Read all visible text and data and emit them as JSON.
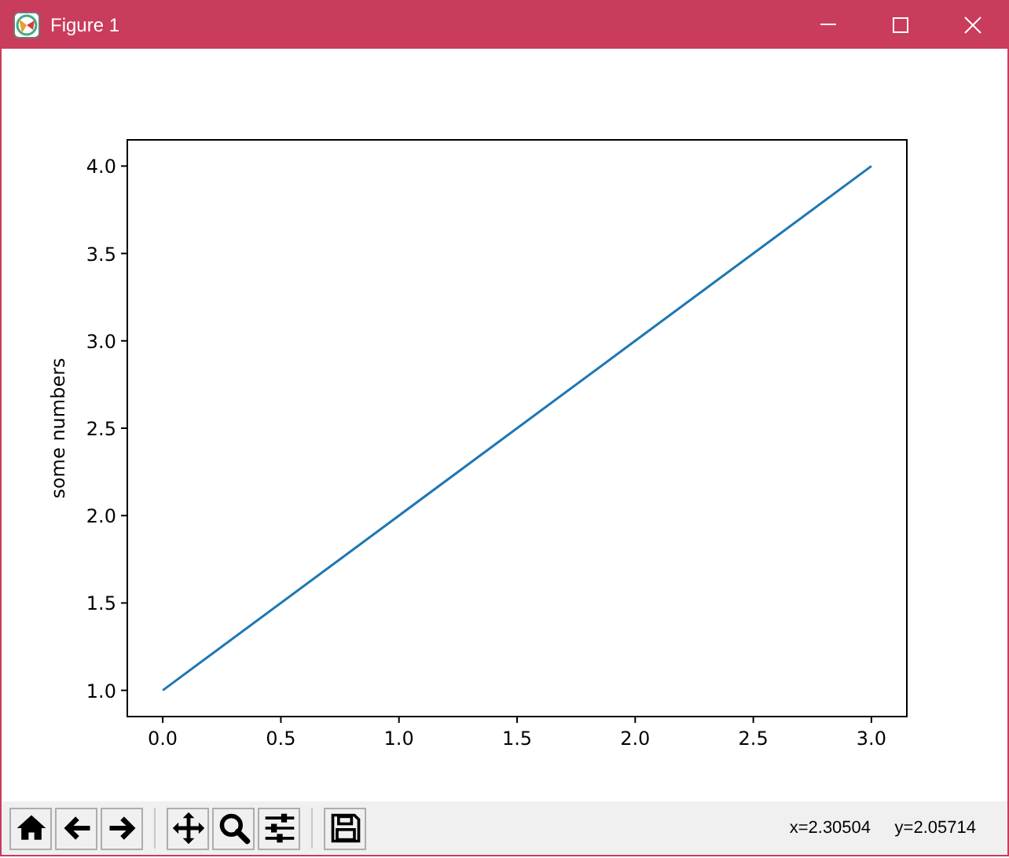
{
  "window": {
    "title": "Figure 1"
  },
  "figure": {
    "chart_data": {
      "type": "line",
      "ylabel": "some numbers",
      "x": [
        0,
        1,
        2,
        3
      ],
      "series": [
        {
          "color": "#1f77b4",
          "values": [
            1,
            2,
            3,
            4
          ]
        }
      ],
      "xlim": [
        -0.15,
        3.15
      ],
      "ylim": [
        0.85,
        4.15
      ],
      "xticks": [
        {
          "value": 0,
          "label": "0.0"
        },
        {
          "value": 0.5,
          "label": "0.5"
        },
        {
          "value": 1,
          "label": "1.0"
        },
        {
          "value": 1.5,
          "label": "1.5"
        },
        {
          "value": 2,
          "label": "2.0"
        },
        {
          "value": 2.5,
          "label": "2.5"
        },
        {
          "value": 3,
          "label": "3.0"
        }
      ],
      "yticks": [
        {
          "value": 1,
          "label": "1.0"
        },
        {
          "value": 1.5,
          "label": "1.5"
        },
        {
          "value": 2,
          "label": "2.0"
        },
        {
          "value": 2.5,
          "label": "2.5"
        },
        {
          "value": 3,
          "label": "3.0"
        },
        {
          "value": 3.5,
          "label": "3.5"
        },
        {
          "value": 4,
          "label": "4.0"
        }
      ]
    }
  },
  "toolbar": {
    "buttons": [
      {
        "kind": "home"
      },
      {
        "kind": "back"
      },
      {
        "kind": "forward"
      },
      {
        "kind": "separator"
      },
      {
        "kind": "pan"
      },
      {
        "kind": "zoom"
      },
      {
        "kind": "configure"
      },
      {
        "kind": "separator"
      },
      {
        "kind": "save"
      }
    ],
    "coordinates": "x=2.30504     y=2.05714"
  }
}
